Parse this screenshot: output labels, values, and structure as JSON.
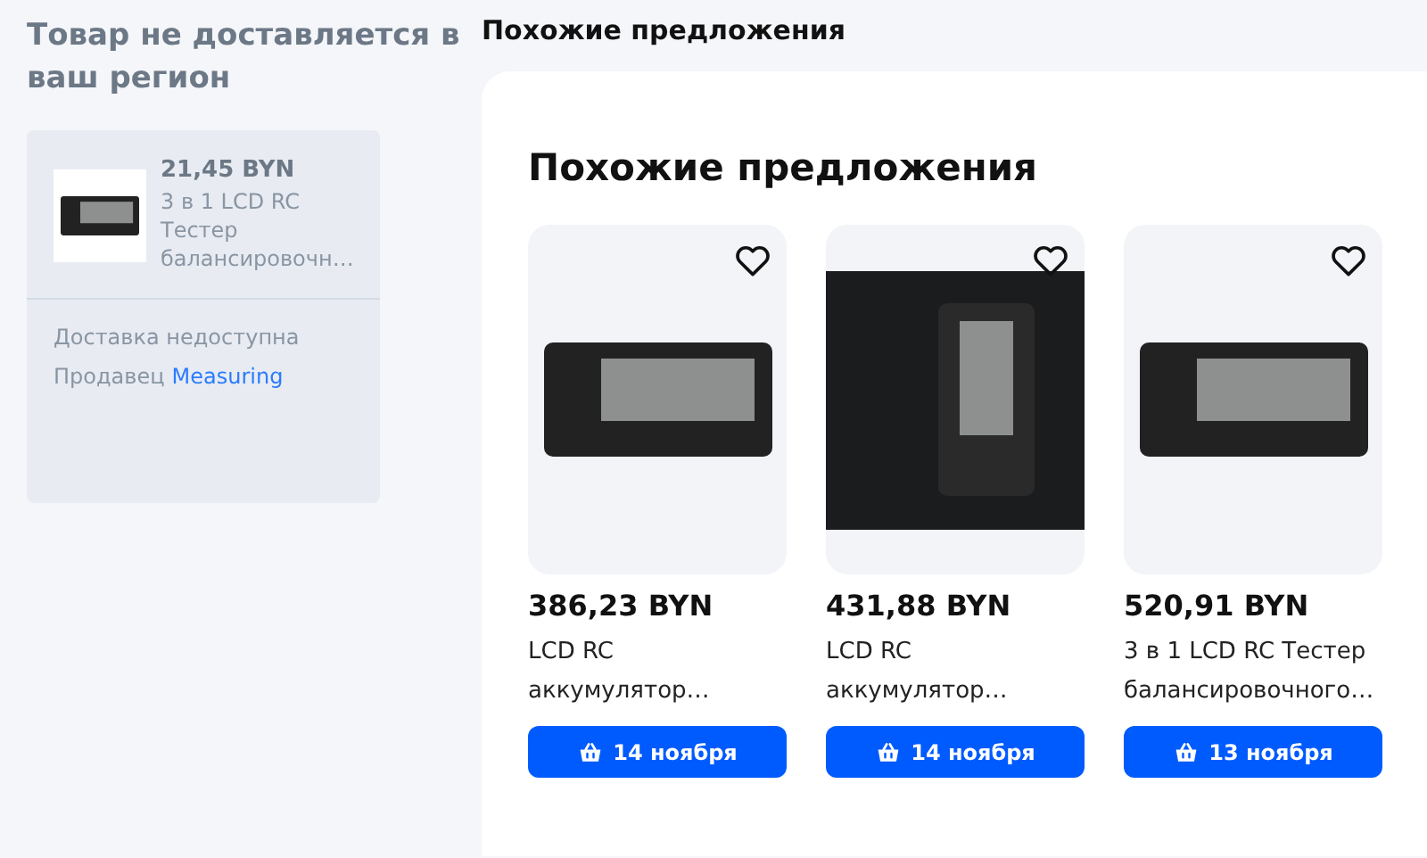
{
  "notice": {
    "title": "Товар не доставляется в ваш регион"
  },
  "product": {
    "price": "21,45 BYN",
    "title_lines": [
      "3 в 1 LCD RC",
      "Тестер",
      "балансировочн…"
    ],
    "delivery": "Доставка недоступна",
    "seller_label": "Продавец",
    "seller": "Measuring"
  },
  "section_title": "Похожие предложения",
  "panel_title": "Похожие предложения",
  "offers": [
    {
      "kind": "device",
      "price": "386,23 BYN",
      "title_lines": [
        "LCD RC",
        "аккумулятор…"
      ],
      "delivery": "14 ноября",
      "favorite": false
    },
    {
      "kind": "dark",
      "price": "431,88 BYN",
      "title_lines": [
        "LCD RC",
        "аккумулятор…"
      ],
      "delivery": "14 ноября",
      "favorite": false
    },
    {
      "kind": "device",
      "price": "520,91 BYN",
      "title_lines": [
        "3 в 1 LCD RC Тестер",
        "балансировочного…"
      ],
      "delivery": "13 ноября",
      "favorite": false
    }
  ]
}
